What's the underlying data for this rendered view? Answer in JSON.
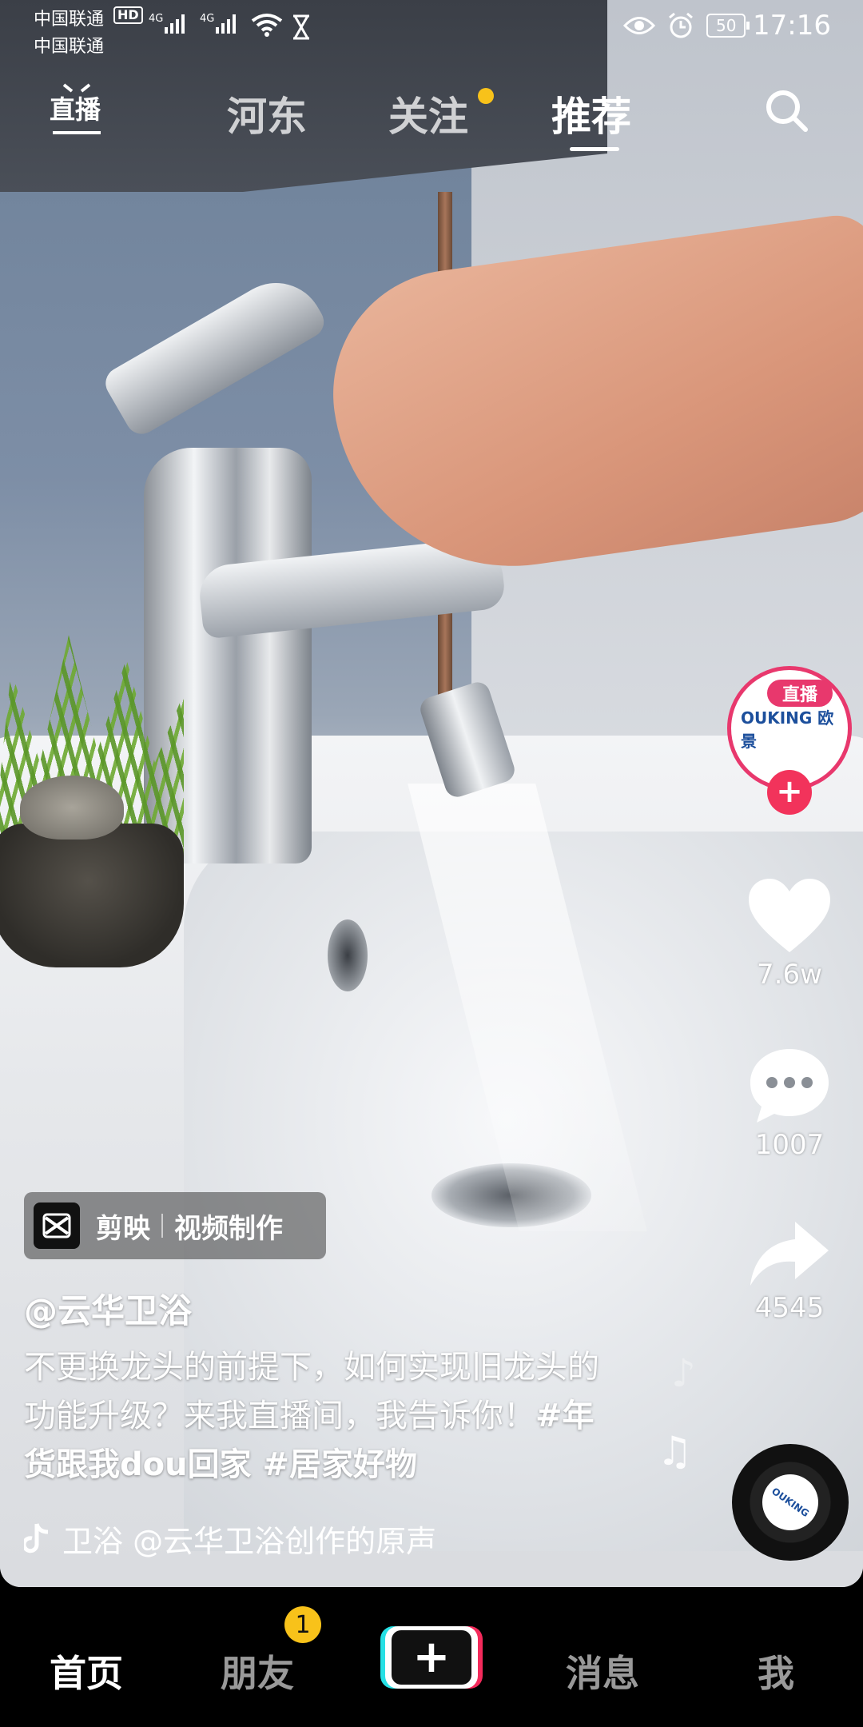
{
  "status_bar": {
    "carrier_1": "中国联通",
    "carrier_2": "中国联通",
    "hd": "HD",
    "network_1": "4G",
    "network_2": "4G",
    "battery": "50",
    "time": "17:16"
  },
  "top_nav": {
    "live_label": "直播",
    "tabs": [
      "河东",
      "关注",
      "推荐"
    ],
    "active_tab": "推荐"
  },
  "right_rail": {
    "live_tag": "直播",
    "avatar_brand": "OUKING 欧景",
    "follow_symbol": "+",
    "likes": "7.6w",
    "comments": "1007",
    "shares": "4545",
    "disc_brand": "OUKING"
  },
  "caption": {
    "app_badge_name": "剪映",
    "app_badge_desc": "视频制作",
    "author": "@云华卫浴",
    "description": "不更换龙头的前提下，如何实现旧龙头的功能升级？来我直播间，我告诉你！",
    "hashtags": "#年货跟我dou回家 #居家好物",
    "music": "卫浴    @云华卫浴创作的原声"
  },
  "bottom_nav": {
    "items": [
      "首页",
      "朋友",
      "消息",
      "我"
    ],
    "active": "首页",
    "friends_badge": "1",
    "plus_symbol": "+"
  },
  "colors": {
    "accent_pink": "#f2335b",
    "badge_yellow": "#f8c21a",
    "tiktok_cyan": "#26e0e5"
  }
}
